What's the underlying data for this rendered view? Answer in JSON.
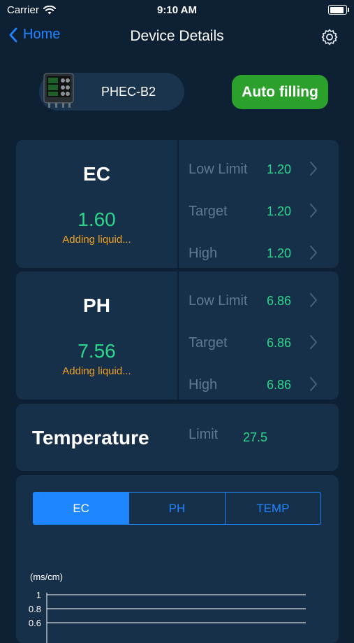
{
  "status_bar": {
    "carrier": "Carrier",
    "time": "9:10 AM"
  },
  "nav": {
    "back_label": "Home",
    "title": "Device Details"
  },
  "device": {
    "name": "PHEC-B2",
    "action_label": "Auto filling"
  },
  "ec": {
    "title": "EC",
    "value": "1.60",
    "status": "Adding liquid...",
    "rows": [
      {
        "label": "Low Limit",
        "value": "1.20"
      },
      {
        "label": "Target",
        "value": "1.20"
      },
      {
        "label": "High",
        "value": "1.20"
      }
    ]
  },
  "ph": {
    "title": "PH",
    "value": "7.56",
    "status": "Adding liquid...",
    "rows": [
      {
        "label": "Low Limit",
        "value": "6.86"
      },
      {
        "label": "Target",
        "value": "6.86"
      },
      {
        "label": "High",
        "value": "6.86"
      }
    ]
  },
  "temperature": {
    "title": "Temperature",
    "limit_label": "Limit",
    "limit_value": "27.5"
  },
  "chart": {
    "tabs": [
      "EC",
      "PH",
      "TEMP"
    ],
    "selected_tab": "EC",
    "unit": "(ms/cm)",
    "y_ticks": [
      "1",
      "0.8",
      "0.6"
    ]
  },
  "colors": {
    "background": "#0e2034",
    "card": "#17304a",
    "accent": "#1e86ff",
    "value_green": "#2bd68a",
    "status_orange": "#f0a020",
    "button_green": "#2ba02b"
  },
  "chart_data": {
    "type": "line",
    "title": "",
    "xlabel": "",
    "ylabel": "(ms/cm)",
    "y_ticks": [
      1,
      0.8,
      0.6
    ],
    "ylim": [
      0.6,
      1
    ],
    "series": []
  }
}
